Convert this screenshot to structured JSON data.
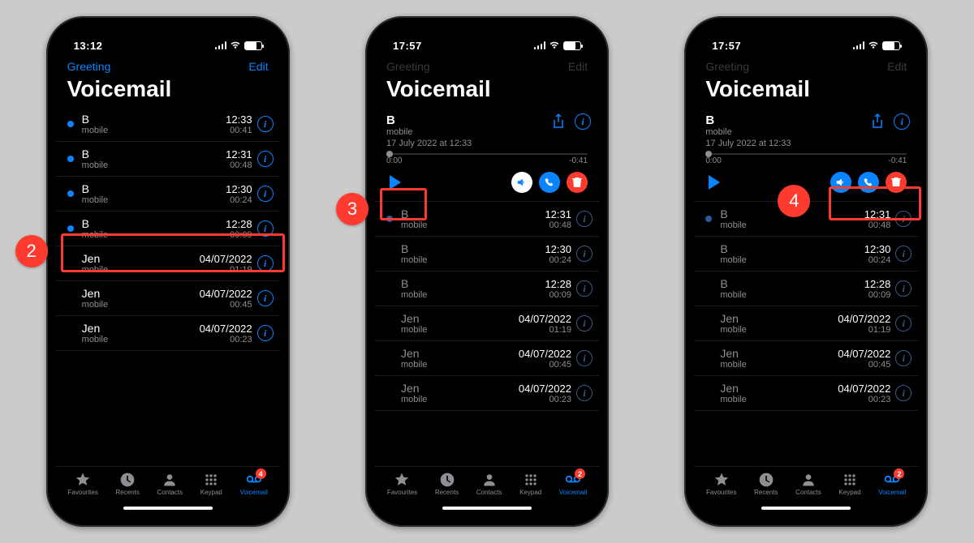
{
  "steps": {
    "s2": "2",
    "s3": "3",
    "s4": "4"
  },
  "nav": {
    "greeting": "Greeting",
    "edit": "Edit",
    "title": "Voicemail"
  },
  "tabs": {
    "favourites": "Favourites",
    "recents": "Recents",
    "contacts": "Contacts",
    "keypad": "Keypad",
    "voicemail": "Voicemail"
  },
  "phone1": {
    "clock": "13:12",
    "badge": "4",
    "items": [
      {
        "name": "B",
        "sub": "mobile",
        "when": "12:33",
        "dur": "00:41",
        "unread": true
      },
      {
        "name": "B",
        "sub": "mobile",
        "when": "12:31",
        "dur": "00:48",
        "unread": true
      },
      {
        "name": "B",
        "sub": "mobile",
        "when": "12:30",
        "dur": "00:24",
        "unread": true
      },
      {
        "name": "B",
        "sub": "mobile",
        "when": "12:28",
        "dur": "00:09",
        "unread": true
      },
      {
        "name": "Jen",
        "sub": "mobile",
        "when": "04/07/2022",
        "dur": "01:19",
        "unread": false
      },
      {
        "name": "Jen",
        "sub": "mobile",
        "when": "04/07/2022",
        "dur": "00:45",
        "unread": false
      },
      {
        "name": "Jen",
        "sub": "mobile",
        "when": "04/07/2022",
        "dur": "00:23",
        "unread": false
      }
    ]
  },
  "expanded": {
    "name": "B",
    "sub": "mobile",
    "date": "17 July 2022 at 12:33",
    "start": "0:00",
    "end": "-0:41"
  },
  "phone2": {
    "clock": "17:57",
    "badge": "2",
    "items": [
      {
        "name": "B",
        "sub": "mobile",
        "when": "12:31",
        "dur": "00:48",
        "unread": true
      },
      {
        "name": "B",
        "sub": "mobile",
        "when": "12:30",
        "dur": "00:24",
        "unread": false
      },
      {
        "name": "B",
        "sub": "mobile",
        "when": "12:28",
        "dur": "00:09",
        "unread": false
      },
      {
        "name": "Jen",
        "sub": "mobile",
        "when": "04/07/2022",
        "dur": "01:19",
        "unread": false
      },
      {
        "name": "Jen",
        "sub": "mobile",
        "when": "04/07/2022",
        "dur": "00:45",
        "unread": false
      },
      {
        "name": "Jen",
        "sub": "mobile",
        "when": "04/07/2022",
        "dur": "00:23",
        "unread": false
      }
    ]
  },
  "phone3": {
    "clock": "17:57",
    "badge": "2",
    "items": [
      {
        "name": "B",
        "sub": "mobile",
        "when": "12:31",
        "dur": "00:48",
        "unread": true
      },
      {
        "name": "B",
        "sub": "mobile",
        "when": "12:30",
        "dur": "00:24",
        "unread": false
      },
      {
        "name": "B",
        "sub": "mobile",
        "when": "12:28",
        "dur": "00:09",
        "unread": false
      },
      {
        "name": "Jen",
        "sub": "mobile",
        "when": "04/07/2022",
        "dur": "01:19",
        "unread": false
      },
      {
        "name": "Jen",
        "sub": "mobile",
        "when": "04/07/2022",
        "dur": "00:45",
        "unread": false
      },
      {
        "name": "Jen",
        "sub": "mobile",
        "when": "04/07/2022",
        "dur": "00:23",
        "unread": false
      }
    ]
  }
}
